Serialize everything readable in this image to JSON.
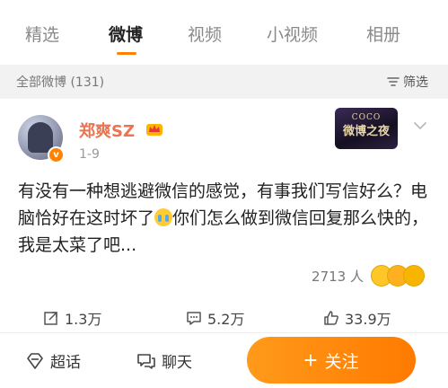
{
  "tabs": [
    "精选",
    "微博",
    "视频",
    "小视频",
    "相册"
  ],
  "active_tab": "微博",
  "accent_color": "#ff8200",
  "filterbar": {
    "count_label": "全部微博 (131)",
    "filter_label": "筛选",
    "filter_icon": "filter-icon"
  },
  "post": {
    "username": "郑爽SZ",
    "verified_badge": "v",
    "member_icon": "crown-icon",
    "date": "1-9",
    "event_badge": {
      "line1": "COCO",
      "line2": "微博之夜"
    },
    "text_part1": "有没有一种想逃避微信的感觉，有事我们写信好么？电脑恰好在这时坏了",
    "text_part2": "你们怎么做到微信回复那么快的，我是太菜了吧...",
    "emoji_in_text": "crying-emoji",
    "reaction_count": "2713 人",
    "actions": {
      "repost": "1.3万",
      "comment": "5.2万",
      "like": "33.9万"
    }
  },
  "bottombar": {
    "topic_label": "超话",
    "chat_label": "聊天",
    "follow_label": "关注"
  }
}
